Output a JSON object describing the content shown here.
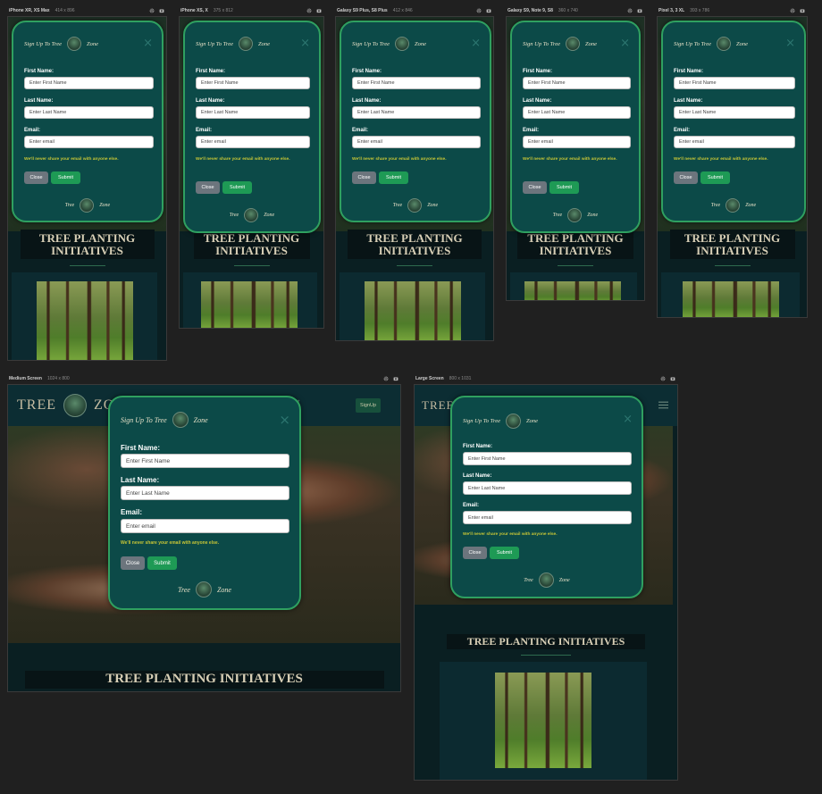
{
  "frames": [
    {
      "id": "iphone-xr",
      "name": "iPhone XR, XS Max",
      "dims": "414 x 896"
    },
    {
      "id": "iphone-x",
      "name": "iPhone XS, X",
      "dims": "375 x 812"
    },
    {
      "id": "galaxy-s9plus",
      "name": "Galaxy S9 Plus, S8 Plus",
      "dims": "412 x 846"
    },
    {
      "id": "galaxy-s9",
      "name": "Galaxy S9, Note 9, S8",
      "dims": "360 x 740"
    },
    {
      "id": "pixel3xl",
      "name": "Pixel 3, 3 XL",
      "dims": "393 x 786"
    },
    {
      "id": "medium",
      "name": "Medium Screen",
      "dims": "1024 x 800"
    },
    {
      "id": "large",
      "name": "Large Screen",
      "dims": "800 x 1031"
    }
  ],
  "modal": {
    "title_prefix": "Sign Up To Tree",
    "title_suffix": "Zone",
    "close_symbol": "×",
    "first_name_label": "First Name:",
    "first_name_placeholder": "Enter First Name",
    "last_name_label": "Last Name:",
    "last_name_placeholder": "Enter Last Name",
    "email_label": "Email:",
    "email_placeholder": "Enter email",
    "note": "We'll never share your email with anyone else.",
    "close_button": "Close",
    "submit_button": "Submit",
    "footer_left": "Tree",
    "footer_right": "Zone"
  },
  "page": {
    "section_title": "TREE PLANTING INITIATIVES",
    "section_title_line1": "TREE PLANTING",
    "section_title_line2": "INITIATIVES",
    "nav_brand_left": "TREE",
    "nav_brand_right": "ZONE",
    "nav_link_partial": "t",
    "nav_signup": "SignUp",
    "menu_icon": "hamburger-icon"
  },
  "colors": {
    "accent": "#1e9a55",
    "modal_bg": "#0c4a48",
    "modal_border": "#2fa060",
    "page_bg": "#202020",
    "note": "#c8c636",
    "title": "#d8cfb6"
  }
}
